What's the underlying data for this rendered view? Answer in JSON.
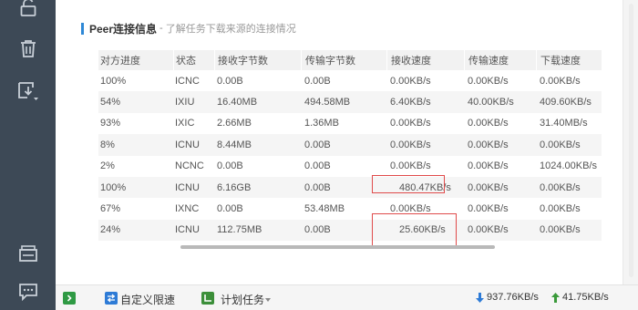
{
  "sidebar": {
    "buttons": [
      {
        "icon": "unlock-icon"
      },
      {
        "icon": "trash-icon"
      },
      {
        "icon": "download-folder-icon"
      },
      {
        "icon": "window-icon"
      },
      {
        "icon": "chat-icon"
      }
    ]
  },
  "section": {
    "title": "Peer连接信息",
    "separator": "-",
    "subtitle": "了解任务下载来源的连接情况"
  },
  "table": {
    "columns": [
      "对方进度",
      "状态",
      "接收字节数",
      "传输字节数",
      "接收速度",
      "传输速度",
      "下载速度"
    ],
    "rows": [
      [
        "100%",
        "ICNC",
        "0.00B",
        "0.00B",
        "0.00KB/s",
        "0.00KB/s",
        "0.00KB/s"
      ],
      [
        "54%",
        "IXIU",
        "16.40MB",
        "494.58MB",
        "6.40KB/s",
        "40.00KB/s",
        "409.60KB/s"
      ],
      [
        "93%",
        "IXIC",
        "2.66MB",
        "1.36MB",
        "0.00KB/s",
        "0.00KB/s",
        "31.40MB/s"
      ],
      [
        "8%",
        "ICNU",
        "8.44MB",
        "0.00B",
        "0.00KB/s",
        "0.00KB/s",
        "0.00KB/s"
      ],
      [
        "2%",
        "NCNC",
        "0.00B",
        "0.00B",
        "0.00KB/s",
        "0.00KB/s",
        "1024.00KB/s"
      ],
      [
        "100%",
        "ICNU",
        "6.16GB",
        "0.00B",
        "480.47KB/s",
        "0.00KB/s",
        "0.00KB/s"
      ],
      [
        "67%",
        "IXNC",
        "0.00B",
        "53.48MB",
        "0.00KB/s",
        "0.00KB/s",
        "0.00KB/s"
      ],
      [
        "24%",
        "ICNU",
        "112.75MB",
        "0.00B",
        "25.60KB/s",
        "0.00KB/s",
        "0.00KB/s"
      ]
    ]
  },
  "statusbar": {
    "speed_limit_label": "自定义限速",
    "schedule_label": "计划任务",
    "download_speed": "937.76KB/s",
    "upload_speed": "41.75KB/s"
  },
  "colors": {
    "sidebar_bg": "#3d4956",
    "accent_blue": "#2e88d6",
    "highlight_red": "#e04b4b",
    "download_arrow": "#2e7bd6",
    "upload_arrow": "#3a9a3a"
  }
}
